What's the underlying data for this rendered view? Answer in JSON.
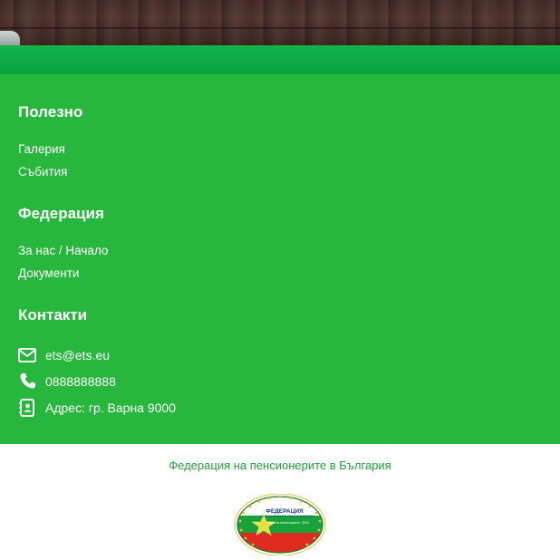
{
  "footer": {
    "useful": {
      "heading": "Полезно",
      "links": [
        "Галерия",
        "Събития"
      ]
    },
    "federation": {
      "heading": "Федерация",
      "links": [
        "За нас / Начало",
        "Документи"
      ]
    },
    "contacts": {
      "heading": "Контакти",
      "items": [
        {
          "icon": "envelope-icon",
          "text": "ets@ets.eu"
        },
        {
          "icon": "phone-icon",
          "text": "0888888888"
        },
        {
          "icon": "address-book-icon",
          "text": "Адрес: гр. Варна 9000"
        }
      ]
    }
  },
  "bottom": {
    "tagline": "Федерация на пенсионерите в България",
    "logo": {
      "name": "federation-logo",
      "lettering": [
        "ФЕДЕРАЦИЯ",
        "НА БЪЛГАРСКИТЕ ПЕНСИОНЕРИТЕ",
        "Съюз на пенсионерите - 2004"
      ]
    }
  },
  "colors": {
    "footer_green": "#28b73d",
    "band_green": "#13b44c",
    "tagline_green": "#1fa33a",
    "flag_white": "#ffffff",
    "flag_green": "#17a33a",
    "flag_red": "#e02b20"
  }
}
